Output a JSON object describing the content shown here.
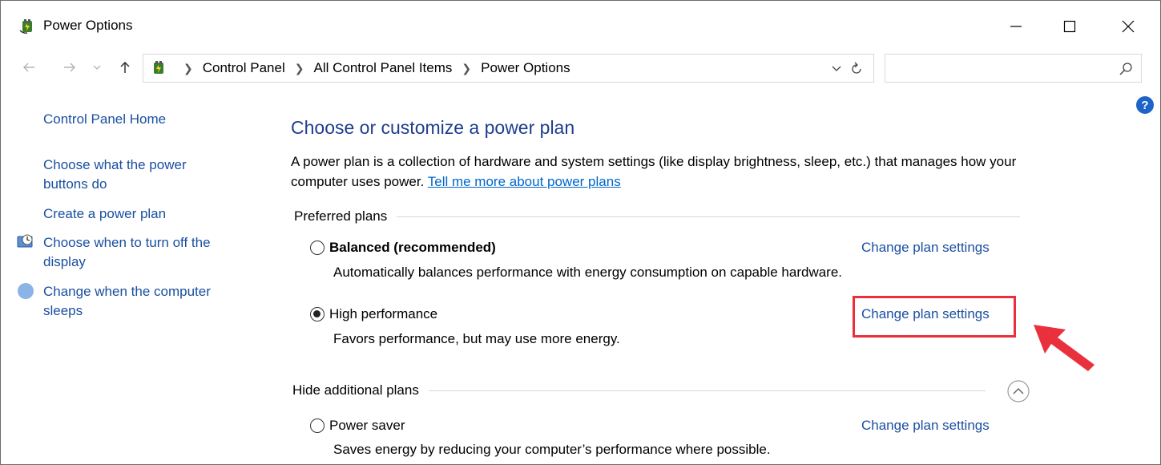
{
  "window": {
    "title": "Power Options",
    "controls": {
      "minimize": "minimize",
      "maximize": "maximize",
      "close": "close"
    }
  },
  "address_bar": {
    "crumbs": [
      "Control Panel",
      "All Control Panel Items",
      "Power Options"
    ],
    "search_placeholder": ""
  },
  "left_nav": {
    "home": "Control Panel Home",
    "links": [
      "Choose what the power buttons do",
      "Create a power plan",
      "Choose when to turn off the display",
      "Change when the computer sleeps"
    ]
  },
  "main": {
    "heading": "Choose or customize a power plan",
    "description": "A power plan is a collection of hardware and system settings (like display brightness, sleep, etc.) that manages how your computer uses power. ",
    "description_link": "Tell me more about power plans",
    "preferred_header": "Preferred plans",
    "hide_header": "Hide additional plans",
    "change_link": "Change plan settings",
    "plans": [
      {
        "name": "Balanced (recommended)",
        "desc": "Automatically balances performance with energy consumption on capable hardware.",
        "selected": false
      },
      {
        "name": "High performance",
        "desc": "Favors performance, but may use more energy.",
        "selected": true
      },
      {
        "name": "Power saver",
        "desc": "Saves energy by reducing your computer’s performance where possible.",
        "selected": false
      }
    ]
  },
  "colors": {
    "link": "#1a4fa0",
    "heading": "#1e3e8e",
    "highlight": "#e8313c"
  }
}
